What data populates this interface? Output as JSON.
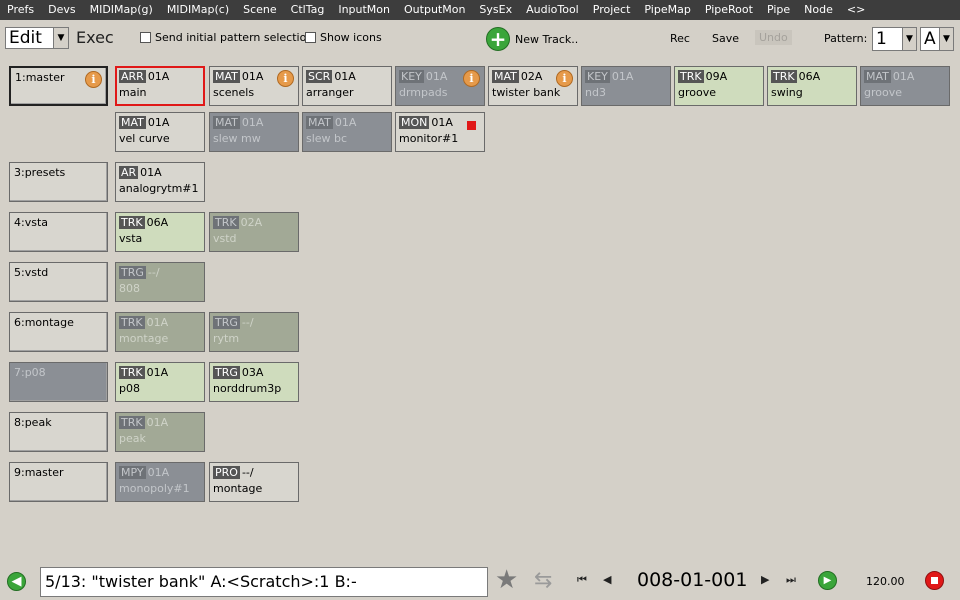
{
  "menubar": {
    "items": [
      "Prefs",
      "Devs",
      "MIDIMap(g)",
      "MIDIMap(c)",
      "Scene",
      "CtlTag",
      "InputMon",
      "OutputMon",
      "SysEx",
      "AudioTool",
      "Project",
      "PipeMap",
      "PipeRoot",
      "Pipe",
      "Node",
      "<>"
    ]
  },
  "toolbar": {
    "mode_value": "Edit",
    "exec_label": "Exec",
    "send_initial_label": "Send initial pattern selection",
    "show_icons_label": "Show icons",
    "new_track_label": "New Track..",
    "rec_label": "Rec",
    "save_label": "Save",
    "undo_label": "Undo",
    "pattern_label": "Pattern:",
    "pattern_number": "1",
    "pattern_letter": "A"
  },
  "rows": [
    {
      "scene": "1:master",
      "cells": [
        {
          "type": "ARR",
          "pattern": "01A",
          "name": "main"
        },
        {
          "type": "MAT",
          "pattern": "01A",
          "name": "scenels"
        },
        {
          "type": "SCR",
          "pattern": "01A",
          "name": "arranger"
        },
        {
          "type": "KEY",
          "pattern": "01A",
          "name": "drmpads"
        },
        {
          "type": "MAT",
          "pattern": "02A",
          "name": "twister bank"
        },
        {
          "type": "KEY",
          "pattern": "01A",
          "name": "nd3"
        },
        {
          "type": "TRK",
          "pattern": "09A",
          "name": "groove"
        },
        {
          "type": "TRK",
          "pattern": "06A",
          "name": "swing"
        },
        {
          "type": "MAT",
          "pattern": "01A",
          "name": "groove"
        }
      ]
    },
    {
      "scene": "",
      "cells": [
        {
          "type": "MAT",
          "pattern": "01A",
          "name": "vel curve"
        },
        {
          "type": "MAT",
          "pattern": "01A",
          "name": "slew mw"
        },
        {
          "type": "MAT",
          "pattern": "01A",
          "name": "slew bc"
        },
        {
          "type": "MON",
          "pattern": "01A",
          "name": "monitor#1"
        }
      ]
    },
    {
      "scene": "3:presets",
      "cells": [
        {
          "type": "AR",
          "pattern": "01A",
          "name": "analogrytm#1"
        }
      ]
    },
    {
      "scene": "4:vsta",
      "cells": [
        {
          "type": "TRK",
          "pattern": "06A",
          "name": "vsta"
        },
        {
          "type": "TRK",
          "pattern": "02A",
          "name": "vstd"
        }
      ]
    },
    {
      "scene": "5:vstd",
      "cells": [
        {
          "type": "TRG",
          "pattern": "--/",
          "name": "808"
        }
      ]
    },
    {
      "scene": "6:montage",
      "cells": [
        {
          "type": "TRK",
          "pattern": "01A",
          "name": "montage"
        },
        {
          "type": "TRG",
          "pattern": "--/",
          "name": "rytm"
        }
      ]
    },
    {
      "scene": "7:p08",
      "cells": [
        {
          "type": "TRK",
          "pattern": "01A",
          "name": "p08"
        },
        {
          "type": "TRG",
          "pattern": "03A",
          "name": "norddrum3p"
        }
      ]
    },
    {
      "scene": "8:peak",
      "cells": [
        {
          "type": "TRK",
          "pattern": "01A",
          "name": "peak"
        }
      ]
    },
    {
      "scene": "9:master",
      "cells": [
        {
          "type": "MPY",
          "pattern": "01A",
          "name": "monopoly#1"
        },
        {
          "type": "PRO",
          "pattern": "--/",
          "name": "montage"
        }
      ]
    }
  ],
  "statusbar": {
    "status_text": "5/13: \"twister bank\" A:<Scratch>:1 B:-",
    "position": "008-01-001",
    "tempo": "120.00"
  },
  "icons": {
    "info": "info-icon",
    "record": "record-icon",
    "back": "back-icon",
    "star": "star-icon",
    "swap": "swap-icon",
    "play": "play-icon",
    "stop": "stop-icon"
  },
  "colors": {
    "menubar_bg": "#3d3d3d",
    "selected_border": "#e01818",
    "track_green": "#cfdcbd",
    "inactive_gray": "#8b8f95",
    "info_orange": "#e69a4a",
    "play_green": "#3aa53a"
  }
}
